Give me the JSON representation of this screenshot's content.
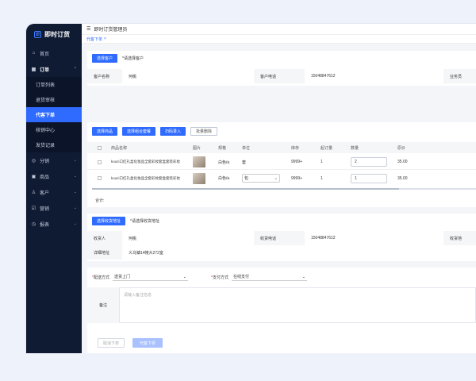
{
  "app": {
    "title": "即时订货",
    "logo_glyph": "即"
  },
  "topbar": {
    "menu_icon": "☰",
    "title": "即时订货管理员"
  },
  "tabbar": {
    "tab_label": "代客下单",
    "close_glyph": "×"
  },
  "sidebar": {
    "items": [
      {
        "name": "home",
        "label": "首页",
        "icon": "⌂"
      },
      {
        "name": "orders",
        "label": "订单",
        "icon": "▦"
      },
      {
        "name": "distribution",
        "label": "分销",
        "icon": "◎"
      },
      {
        "name": "products",
        "label": "商品",
        "icon": "▣"
      },
      {
        "name": "customers",
        "label": "客户",
        "icon": "♙"
      },
      {
        "name": "marketing",
        "label": "营销",
        "icon": "☑"
      },
      {
        "name": "reports",
        "label": "报表",
        "icon": "◷"
      }
    ],
    "sub_items": [
      "订单列表",
      "退货审核",
      "代客下单",
      "核销中心",
      "发货记录"
    ],
    "active_sub": "代客下单"
  },
  "customer": {
    "select_button": "选择客户",
    "hint": "*请选择客户",
    "name_label": "客户名称",
    "name_value": "何桃",
    "phone_label": "客户电话",
    "phone_value": "15048847612",
    "biz_label": "业务员"
  },
  "products": {
    "buttons": [
      "选择商品",
      "选择组合套餐",
      "扫码录入",
      "批量删除"
    ],
    "headers": [
      "商品名称",
      "图片",
      "规格",
      "单位",
      "库存",
      "起订量",
      "数量",
      "原价"
    ],
    "rows": [
      {
        "name": "kouzi口红礼盒化妆品全套彩妆套盒套装彩妆",
        "spec": "白色/a",
        "unit": "套",
        "stock": "9999+",
        "min": "1",
        "qty": "2",
        "price": "35.00"
      },
      {
        "name": "kouzi口红礼盒化妆品全套彩妆套盒套装彩妆",
        "spec": "白色/a",
        "unit": "包",
        "stock": "9999+",
        "min": "1",
        "qty": "1",
        "price": "35.00"
      }
    ],
    "total_label": "合计:"
  },
  "address": {
    "select_button": "选择收货地址",
    "hint": "*请选择收货地址",
    "receiver_label": "收货人",
    "receiver_value": "何桃",
    "phone_label": "收货电话",
    "phone_value": "15048847612",
    "addr_label_short": "收货地",
    "detail_label": "详细地址",
    "detail_value": "义乌镇14幢大272室"
  },
  "delivery": {
    "label": "配送方式",
    "value": "送货上门"
  },
  "payment": {
    "label": "支付方式",
    "value": "在线支付"
  },
  "remark": {
    "label": "备注",
    "placeholder": "请输入备注信息"
  },
  "actions": {
    "cancel": "取消下单",
    "submit": "代客下单"
  },
  "colors": {
    "primary": "#2f6bff",
    "sidebar": "#0f1a33"
  }
}
